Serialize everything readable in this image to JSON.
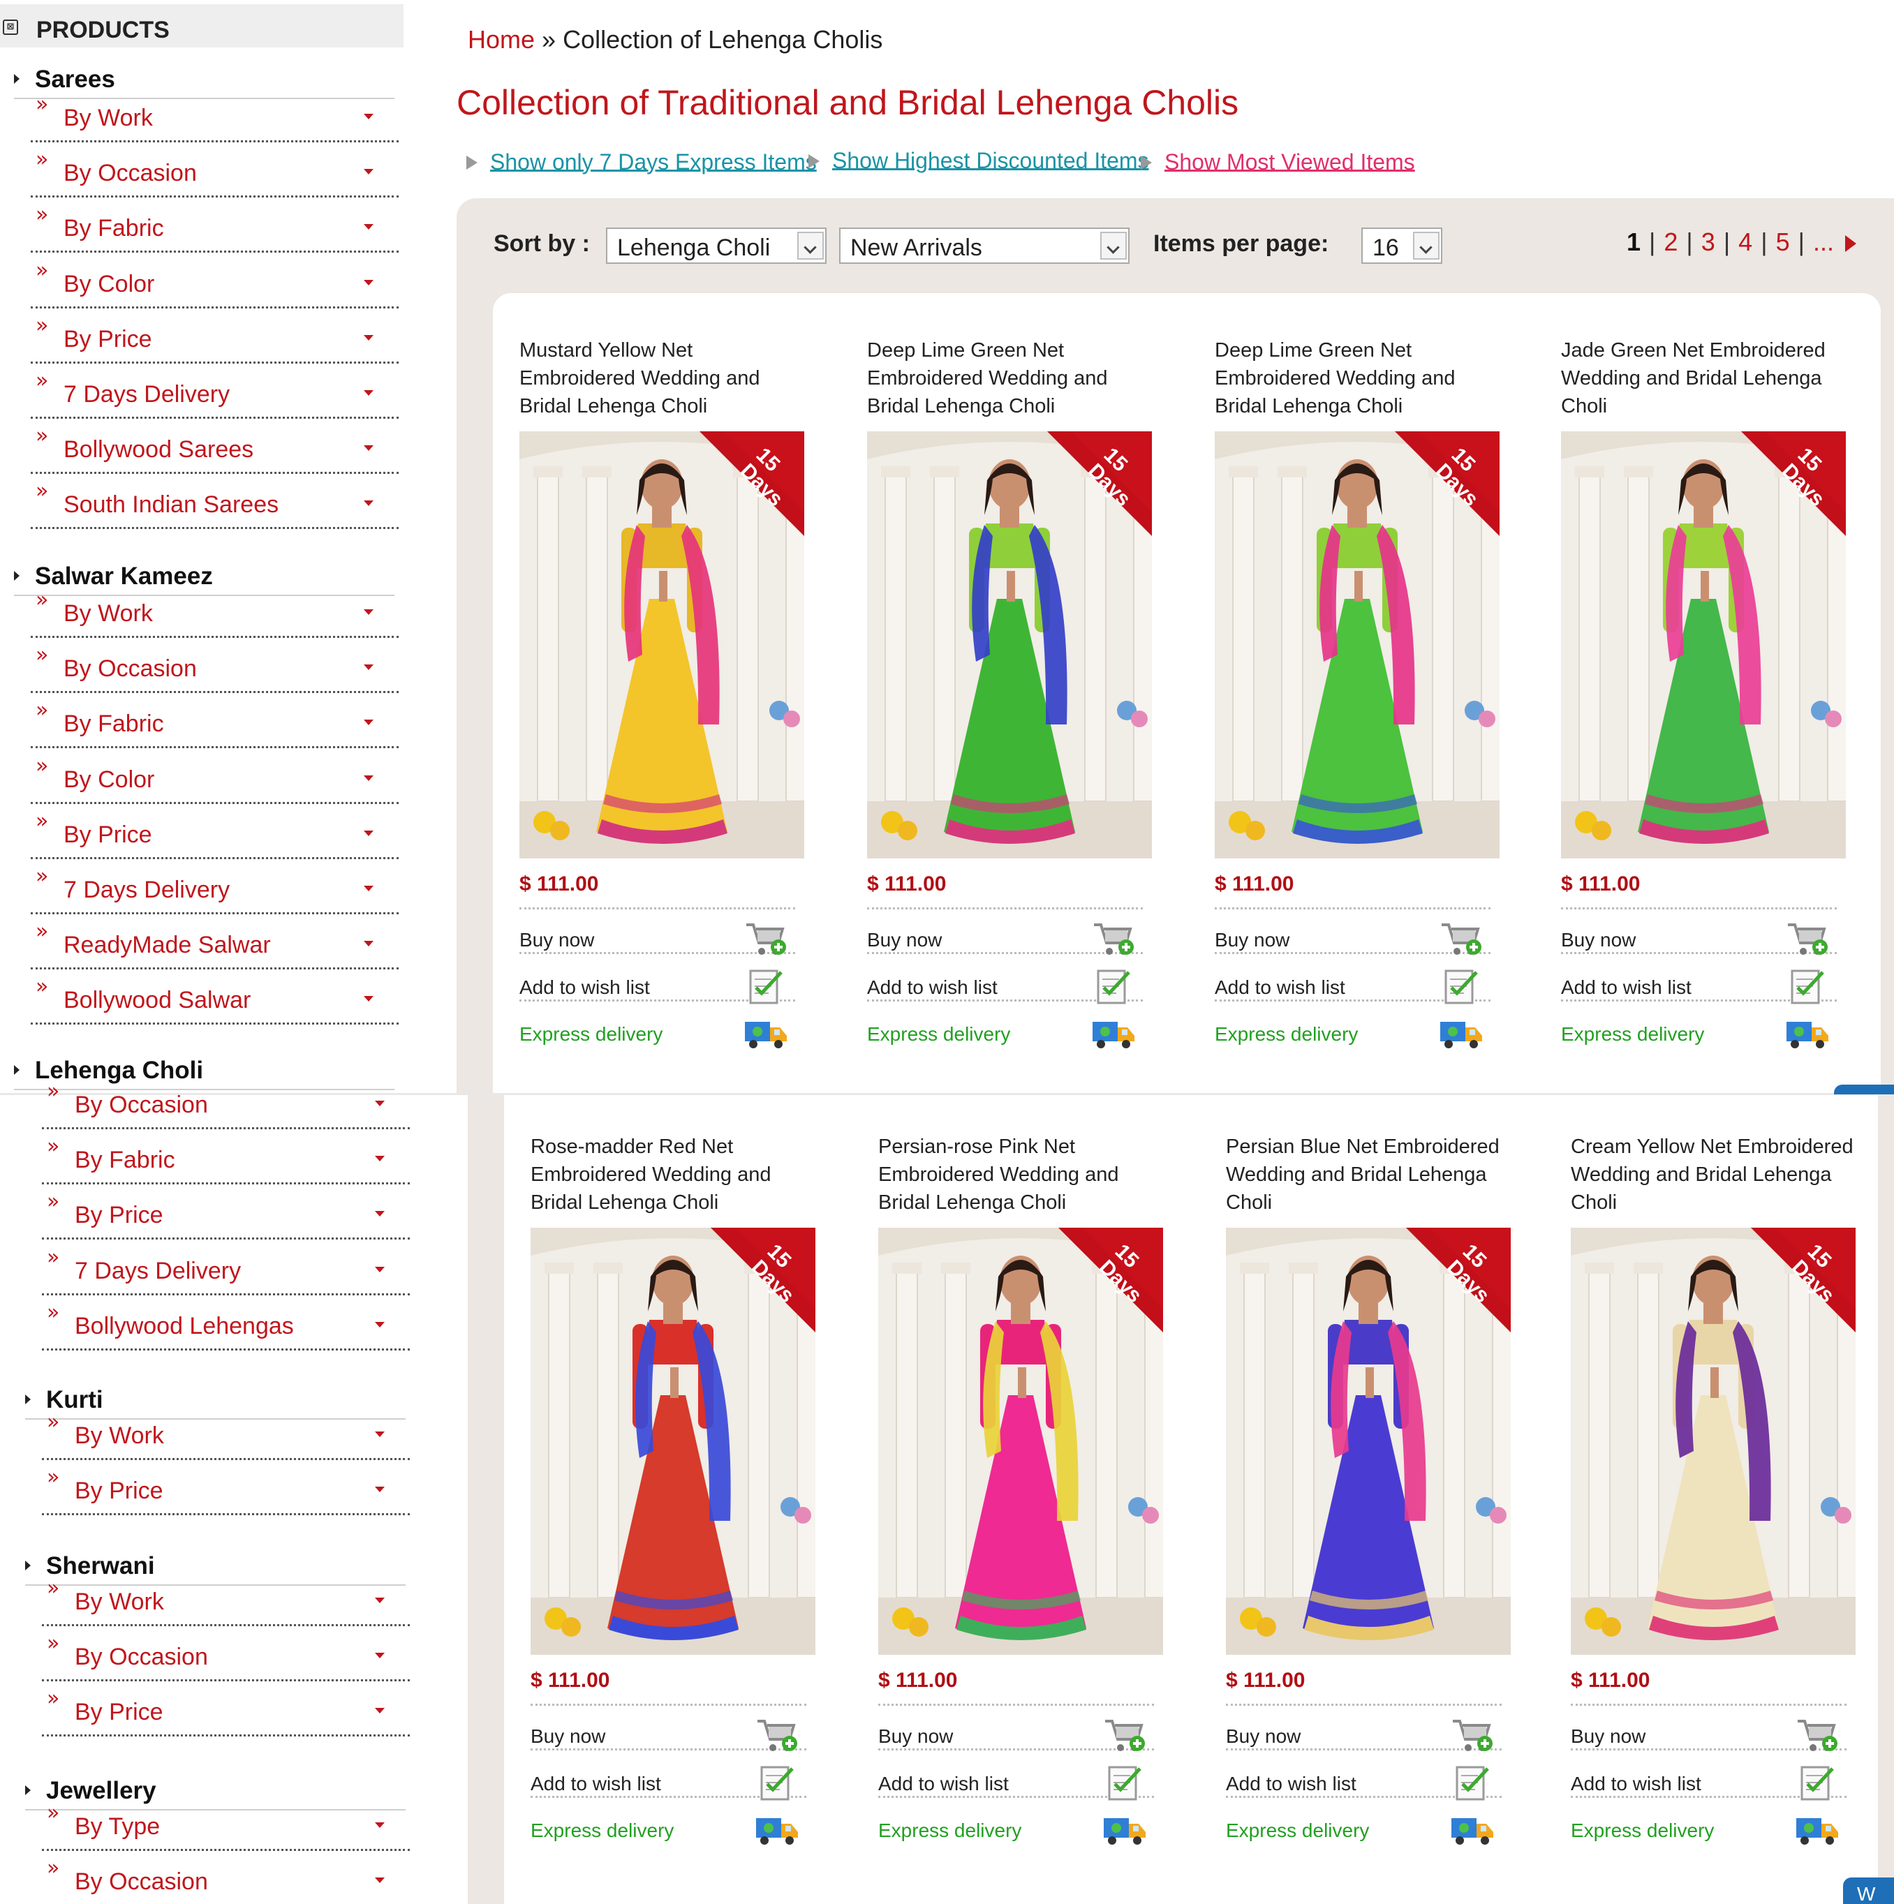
{
  "sidebar": {
    "header": "PRODUCTS",
    "categories": [
      {
        "label": "Sarees",
        "items": [
          "By Work",
          "By Occasion",
          "By Fabric",
          "By Color",
          "By Price",
          "7 Days Delivery",
          "Bollywood Sarees",
          "South Indian Sarees"
        ]
      },
      {
        "label": "Salwar Kameez",
        "items": [
          "By Work",
          "By Occasion",
          "By Fabric",
          "By Color",
          "By Price",
          "7 Days Delivery",
          "ReadyMade Salwar",
          "Bollywood Salwar"
        ]
      },
      {
        "label": "Lehenga Choli",
        "items": [
          "By Occasion",
          "By Fabric",
          "By Price",
          "7 Days Delivery",
          "Bollywood Lehengas"
        ]
      },
      {
        "label": "Kurti",
        "items": [
          "By Work",
          "By Price"
        ]
      },
      {
        "label": "Sherwani",
        "items": [
          "By Work",
          "By Occasion",
          "By Price"
        ]
      },
      {
        "label": "Jewellery",
        "items": [
          "By Type",
          "By Occasion"
        ]
      }
    ]
  },
  "breadcrumb": {
    "home": "Home",
    "separator": "»",
    "current": "Collection of Lehenga Cholis"
  },
  "page_title": "Collection of Traditional and Bridal Lehenga Cholis",
  "filters": {
    "express": "Show only 7 Days Express Items",
    "discount": "Show Highest Discounted Items",
    "viewed": "Show Most Viewed Items"
  },
  "toolbar": {
    "sort_label": "Sort by :",
    "sort_category": "Lehenga Choli",
    "sort_order": "New Arrivals",
    "items_label": "Items per page:",
    "items_value": "16"
  },
  "pagination": {
    "current": "1",
    "pages": [
      "2",
      "3",
      "4",
      "5",
      "..."
    ]
  },
  "side_tab": {
    "label": "W"
  },
  "card_labels": {
    "ribbon_number": "15",
    "ribbon_word": "Days",
    "buy": "Buy now",
    "wish": "Add to wish list",
    "express": "Express delivery"
  },
  "products": [
    {
      "name": "Mustard Yellow Net Embroidered Wedding and Bridal Lehenga Choli",
      "price": "$ 111.00",
      "colors": {
        "top": "#e7b827",
        "skirt": "#f3c52a",
        "dupatta": "#e6347a",
        "border": "#d43a7a"
      }
    },
    {
      "name": "Deep Lime Green Net Embroidered Wedding and Bridal Lehenga Choli",
      "price": "$ 111.00",
      "colors": {
        "top": "#8fcf3a",
        "skirt": "#3fb536",
        "dupatta": "#3440c8",
        "border": "#d43a7a"
      }
    },
    {
      "name": "Deep Lime Green Net Embroidered Wedding and Bridal Lehenga Choli",
      "price": "$ 111.00",
      "colors": {
        "top": "#8fcf3a",
        "skirt": "#4cc23f",
        "dupatta": "#e6348a",
        "border": "#3a5fc8"
      }
    },
    {
      "name": "Jade Green Net Embroidered Wedding and Bridal Lehenga Choli",
      "price": "$ 111.00",
      "colors": {
        "top": "#9ed23a",
        "skirt": "#44b84a",
        "dupatta": "#ea3e96",
        "border": "#d43a7a"
      }
    },
    {
      "name": "Rose-madder Red Net Embroidered Wedding and Bridal Lehenga Choli",
      "price": "$ 111.00",
      "colors": {
        "top": "#d9302a",
        "skirt": "#d63b2b",
        "dupatta": "#3a4ad8",
        "border": "#3a4ad8"
      }
    },
    {
      "name": "Persian-rose Pink Net Embroidered Wedding and Bridal Lehenga Choli",
      "price": "$ 111.00",
      "colors": {
        "top": "#e8247a",
        "skirt": "#ef2a92",
        "dupatta": "#e9d23a",
        "border": "#3fae5a"
      }
    },
    {
      "name": "Persian Blue Net Embroidered Wedding and Bridal Lehenga Choli",
      "price": "$ 111.00",
      "colors": {
        "top": "#4a3cc8",
        "skirt": "#4a3cd2",
        "dupatta": "#e83a8e",
        "border": "#e8c86a"
      }
    },
    {
      "name": "Cream Yellow Net Embroidered Wedding and Bridal Lehenga Choli",
      "price": "$ 111.00",
      "colors": {
        "top": "#e8d6a8",
        "skirt": "#efe3bd",
        "dupatta": "#6a2a9a",
        "border": "#e0407a"
      }
    }
  ],
  "accent_color": "#c0161c"
}
